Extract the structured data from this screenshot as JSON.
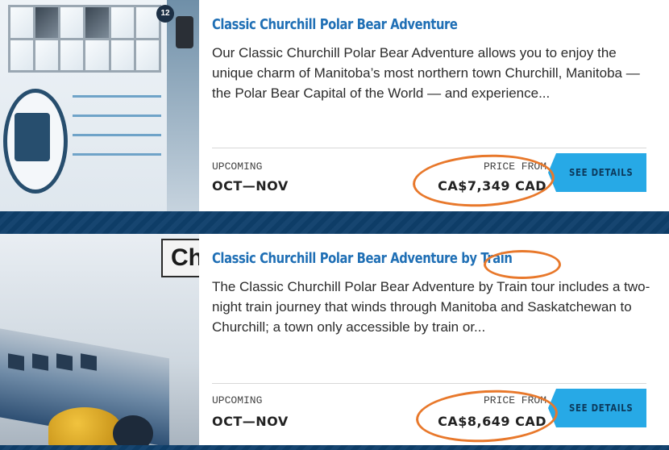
{
  "colors": {
    "page_background": "#0f3f6b",
    "title_blue": "#1f6fb5",
    "button_blue": "#27a9e6",
    "annotation_orange": "#e8782b"
  },
  "tours": [
    {
      "title": "Classic Churchill Polar Bear Adventure",
      "description": "Our Classic Churchill Polar Bear Adventure allows you to enjoy the unique charm of Manitoba’s most northern town Churchill, Manitoba — the Polar Bear Capital of the World — and experience...",
      "upcoming_label": "UPCOMING",
      "upcoming_value": "OCT—NOV",
      "price_label": "PRICE FROM",
      "price_value": "CA$7,349 CAD",
      "button_label": "SEE DETAILS",
      "image_badge_number": "12"
    },
    {
      "title": "Classic Churchill Polar Bear Adventure by Train",
      "description": "The Classic Churchill Polar Bear Adventure by Train tour includes a two-night train journey that winds through Manitoba and Saskatchewan to Churchill; a town only accessible by train or...",
      "upcoming_label": "UPCOMING",
      "upcoming_value": "OCT—NOV",
      "price_label": "PRICE FROM",
      "price_value": "CA$8,649 CAD",
      "button_label": "SEE DETAILS",
      "image_sign_text": "Ch"
    }
  ]
}
